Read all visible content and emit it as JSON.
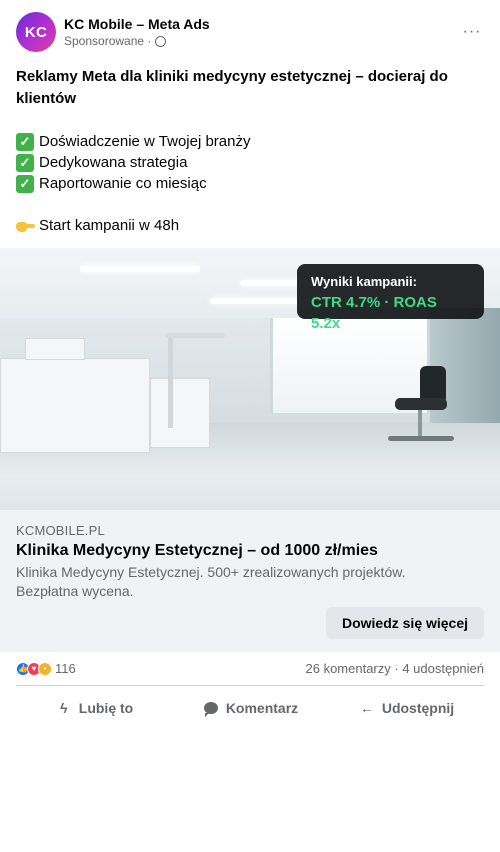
{
  "header": {
    "avatar_text": "KC",
    "page_name": "KC Mobile – Meta Ads",
    "sponsored_label": "Sponsorowane ·",
    "more_label": "···"
  },
  "post": {
    "headline": "Reklamy Meta dla kliniki medycyny estetycznej – docieraj do klientów",
    "checklist": [
      "Doświadczenie w Twojej branży",
      "Dedykowana strategia",
      "Raportowanie co miesiąc"
    ],
    "cta_line": "Start kampanii w 48h"
  },
  "media": {
    "results_title": "Wyniki kampanii:",
    "results_value": "CTR 4.7% · ROAS 5.2x",
    "results_color": "#3ddc84"
  },
  "link": {
    "domain": "KCMOBILE.PL",
    "title": "Klinika Medycyny Estetycznej – od 1000 zł/mies",
    "description": "Klinika Medycyny Estetycznej. 500+ zrealizowanych projektów. Bezpłatna wycena.",
    "cta": "Dowiedz się więcej"
  },
  "engagement": {
    "reaction_count": "116",
    "stats": "26 komentarzy · 4 udostępnień"
  },
  "actions": {
    "like": "Lubię to",
    "comment": "Komentarz",
    "share": "Udostępnij"
  },
  "colors": {
    "avatar_gradient_start": "#6a2bd8",
    "avatar_gradient_end": "#e0409e",
    "like": "#1877f2",
    "love": "#f33e58",
    "wow": "#f7b125"
  },
  "icons": {
    "checklist": "check-mark-button-icon",
    "cta_line": "backhand-index-pointing-right-icon",
    "privacy": "globe-icon",
    "more": "more-options-icon"
  }
}
